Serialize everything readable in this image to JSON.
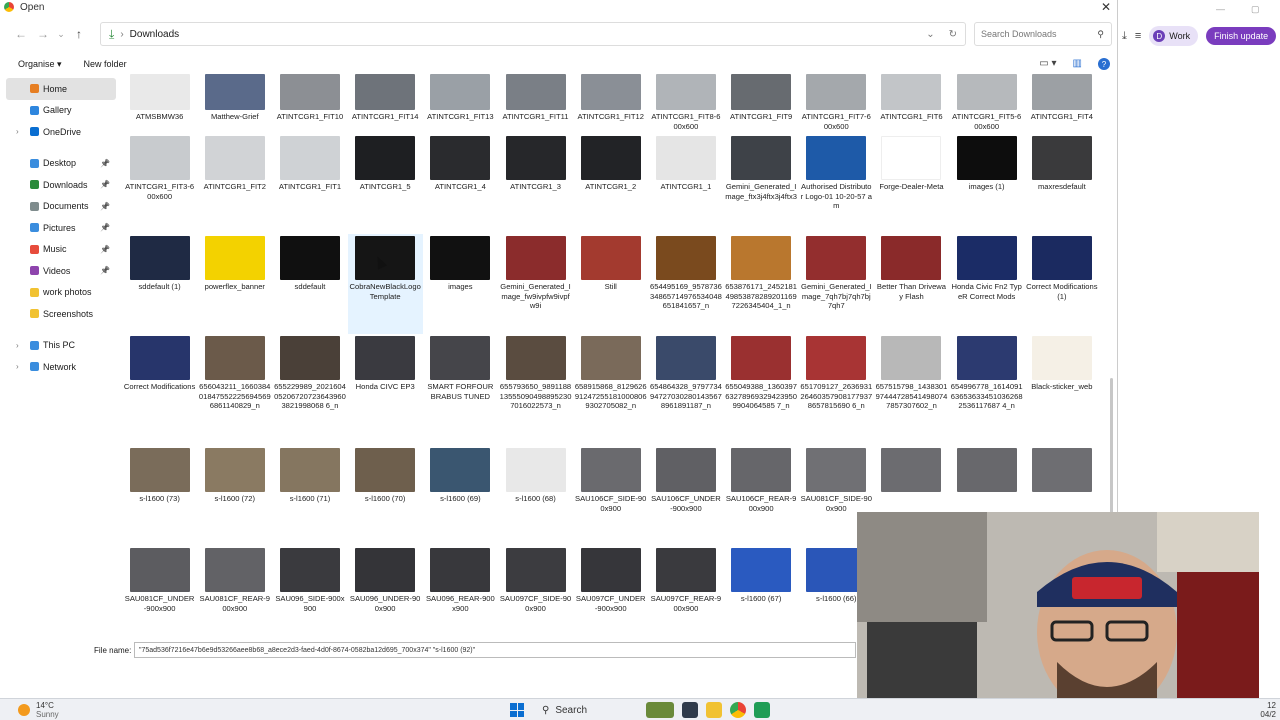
{
  "dialog": {
    "title": "Open",
    "address": {
      "path": "Downloads"
    },
    "search_placeholder": "Search Downloads",
    "commands": {
      "organise": "Organise ▾",
      "new_folder": "New folder"
    },
    "file_name_label": "File name:",
    "file_name_value": "\"75ad536f7216e47b6e9d53266aee8b68_a8ece2d3-faed-4d0f-8674-0582ba12d695_700x374\" \"s-l1600 (92)\""
  },
  "nav": {
    "items": [
      {
        "label": "Home",
        "icon": "home-icon",
        "color": "#e67e22",
        "selected": true,
        "pinned": false,
        "expandable": false
      },
      {
        "label": "Gallery",
        "icon": "gallery-icon",
        "color": "#2e86de",
        "selected": false,
        "pinned": false,
        "expandable": false
      },
      {
        "label": "OneDrive",
        "icon": "cloud-icon",
        "color": "#0a6ed1",
        "selected": false,
        "pinned": false,
        "expandable": true
      },
      {
        "label": "",
        "icon": "",
        "color": "",
        "spacer": true
      },
      {
        "label": "Desktop",
        "icon": "desktop-icon",
        "color": "#3a8dde",
        "selected": false,
        "pinned": true,
        "expandable": false
      },
      {
        "label": "Downloads",
        "icon": "download-icon",
        "color": "#2a8a3a",
        "selected": false,
        "pinned": true,
        "expandable": false
      },
      {
        "label": "Documents",
        "icon": "documents-icon",
        "color": "#7f8c8d",
        "selected": false,
        "pinned": true,
        "expandable": false
      },
      {
        "label": "Pictures",
        "icon": "pictures-icon",
        "color": "#3a8dde",
        "selected": false,
        "pinned": true,
        "expandable": false
      },
      {
        "label": "Music",
        "icon": "music-icon",
        "color": "#e74c3c",
        "selected": false,
        "pinned": true,
        "expandable": false
      },
      {
        "label": "Videos",
        "icon": "videos-icon",
        "color": "#8e44ad",
        "selected": false,
        "pinned": true,
        "expandable": false
      },
      {
        "label": "work photos",
        "icon": "folder-icon",
        "color": "#f1c232",
        "selected": false,
        "pinned": false,
        "expandable": false
      },
      {
        "label": "Screenshots",
        "icon": "folder-icon",
        "color": "#f1c232",
        "selected": false,
        "pinned": false,
        "expandable": false
      },
      {
        "label": "",
        "icon": "",
        "color": "",
        "spacer": true
      },
      {
        "label": "This PC",
        "icon": "pc-icon",
        "color": "#3a8dde",
        "selected": false,
        "pinned": false,
        "expandable": true
      },
      {
        "label": "Network",
        "icon": "network-icon",
        "color": "#3a8dde",
        "selected": false,
        "pinned": false,
        "expandable": true
      }
    ]
  },
  "files": [
    {
      "name": "ATMSBMW36",
      "color": "#e9e9e9"
    },
    {
      "name": "Matthew-Grief",
      "color": "#5a6a8a"
    },
    {
      "name": "ATINTCGR1_FIT10",
      "color": "#8c8f94"
    },
    {
      "name": "ATINTCGR1_FIT14",
      "color": "#6e737a"
    },
    {
      "name": "ATINTCGR1_FIT13",
      "color": "#9aa0a6"
    },
    {
      "name": "ATINTCGR1_FIT11",
      "color": "#7a7f86"
    },
    {
      "name": "ATINTCGR1_FIT12",
      "color": "#8a8f96"
    },
    {
      "name": "ATINTCGR1_FIT8-600x600",
      "color": "#b0b4b8"
    },
    {
      "name": "ATINTCGR1_FIT9",
      "color": "#676b70"
    },
    {
      "name": "ATINTCGR1_FIT7-600x600",
      "color": "#a4a8ac"
    },
    {
      "name": "ATINTCGR1_FIT6",
      "color": "#c2c5c8"
    },
    {
      "name": "ATINTCGR1_FIT5-600x600",
      "color": "#b6b9bc"
    },
    {
      "name": "ATINTCGR1_FIT4",
      "color": "#9ca0a4"
    },
    {
      "name": "ATINTCGR1_FIT3-600x600",
      "color": "#c8cbce"
    },
    {
      "name": "ATINTCGR1_FIT2",
      "color": "#d1d3d6"
    },
    {
      "name": "ATINTCGR1_FIT1",
      "color": "#cfd2d5"
    },
    {
      "name": "ATINTCGR1_5",
      "color": "#1e1f22"
    },
    {
      "name": "ATINTCGR1_4",
      "color": "#2a2b2e"
    },
    {
      "name": "ATINTCGR1_3",
      "color": "#26272a"
    },
    {
      "name": "ATINTCGR1_2",
      "color": "#222326"
    },
    {
      "name": "ATINTCGR1_1",
      "color": "#e5e5e5"
    },
    {
      "name": "Gemini_Generated_Image_ftx3j4ftx3j4ftx3",
      "color": "#3e4248"
    },
    {
      "name": "Authorised Distributor Logo-01 10-20-57 am",
      "color": "#1e5aa8"
    },
    {
      "name": "Forge-Dealer-Meta",
      "color": "#ffffff"
    },
    {
      "name": "images (1)",
      "color": "#0d0d0d"
    },
    {
      "name": "maxresdefault",
      "color": "#3a3a3c"
    },
    {
      "name": "sddefault (1)",
      "color": "#1f2a44"
    },
    {
      "name": "powerflex_banner",
      "color": "#f3d200"
    },
    {
      "name": "sddefault",
      "color": "#101010"
    },
    {
      "name": "CobraNewBlackLogoTemplate",
      "color": "#151515"
    },
    {
      "name": "images",
      "color": "#111111"
    },
    {
      "name": "Gemini_Generated_Image_fw9ivpfw9ivpfw9i",
      "color": "#8b2c2c"
    },
    {
      "name": "Still",
      "color": "#a33a2f"
    },
    {
      "name": "654495169_957873634865714976534048651841657_n",
      "color": "#7a4a1e"
    },
    {
      "name": "653876171_2452181498538782892011697226345404_1_n",
      "color": "#b9772e"
    },
    {
      "name": "Gemini_Generated_Image_7qh7bj7qh7bj7qh7",
      "color": "#932e2e"
    },
    {
      "name": "Better Than Driveway Flash",
      "color": "#8a2a2a"
    },
    {
      "name": "Honda Civic Fn2 TypeR Correct Mods",
      "color": "#1b2c66"
    },
    {
      "name": "Correct Modifications (1)",
      "color": "#1b2a60"
    },
    {
      "name": "Correct Modifications",
      "color": "#27356b"
    },
    {
      "name": "656043211_1660384018475522256945696861140829_n",
      "color": "#6b5a4a"
    },
    {
      "name": "655229989_2021604052067207236439603821998068 6_n",
      "color": "#4a4038"
    },
    {
      "name": "Honda CIVC EP3",
      "color": "#3a3a40"
    },
    {
      "name": "SMART FORFOUR BRABUS TUNED",
      "color": "#45454a"
    },
    {
      "name": "655793650_9891188135550904988952307016022573_n",
      "color": "#5a4c40"
    },
    {
      "name": "658915868_8129626912472551810008069302705082_n",
      "color": "#7a6a5a"
    },
    {
      "name": "654864328_9797734947270302801435678961891187_n",
      "color": "#3a4a6a"
    },
    {
      "name": "655049388_1360397632789693294239509904064585 7_n",
      "color": "#9a3030"
    },
    {
      "name": "651709127_2636931264603579081779378657815690 6_n",
      "color": "#a83434"
    },
    {
      "name": "657515798_1438301974447285414980747857307602_n",
      "color": "#b8b8b8"
    },
    {
      "name": "654996778_1614091636536334510362682536117687 4_n",
      "color": "#2c3a70"
    },
    {
      "name": "Black-sticker_web",
      "color": "#f5f0e6"
    },
    {
      "name": "s-l1600 (73)",
      "color": "#7a6c5a"
    },
    {
      "name": "s-l1600 (72)",
      "color": "#8a7a62"
    },
    {
      "name": "s-l1600 (71)",
      "color": "#857660"
    },
    {
      "name": "s-l1600 (70)",
      "color": "#6e5f4d"
    },
    {
      "name": "s-l1600 (69)",
      "color": "#3a5670"
    },
    {
      "name": "s-l1600 (68)",
      "color": "#e8e8e8"
    },
    {
      "name": "SAU106CF_SIDE-900x900",
      "color": "#6a6a6e"
    },
    {
      "name": "SAU106CF_UNDER-900x900",
      "color": "#606064"
    },
    {
      "name": "SAU106CF_REAR-900x900",
      "color": "#66666a"
    },
    {
      "name": "SAU081CF_SIDE-900x900",
      "color": "#707074"
    },
    {
      "name": "",
      "color": "#6c6c70"
    },
    {
      "name": "",
      "color": "#68686c"
    },
    {
      "name": "",
      "color": "#6e6e72"
    },
    {
      "name": "SAU081CF_UNDER-900x900",
      "color": "#5c5c60"
    },
    {
      "name": "SAU081CF_REAR-900x900",
      "color": "#626266"
    },
    {
      "name": "SAU096_SIDE-900x900",
      "color": "#3a3a3e"
    },
    {
      "name": "SAU096_UNDER-900x900",
      "color": "#343438"
    },
    {
      "name": "SAU096_REAR-900x900",
      "color": "#38383c"
    },
    {
      "name": "SAU097CF_SIDE-900x900",
      "color": "#3c3c40"
    },
    {
      "name": "SAU097CF_UNDER-900x900",
      "color": "#36363a"
    },
    {
      "name": "SAU097CF_REAR-900x900",
      "color": "#3a3a3e"
    },
    {
      "name": "s-l1600 (67)",
      "color": "#2a5ac0"
    },
    {
      "name": "s-l1600 (66)",
      "color": "#2a56b8"
    },
    {
      "name": "",
      "color": "#ffffff"
    },
    {
      "name": "",
      "color": "#ffffff"
    },
    {
      "name": "",
      "color": "#ffffff"
    }
  ],
  "browser": {
    "work_label": "Work",
    "work_initial": "D",
    "finish_label": "Finish update"
  },
  "taskbar": {
    "temp": "14°C",
    "condition": "Sunny",
    "search_label": "Search",
    "time": "12",
    "date": "04/2"
  }
}
